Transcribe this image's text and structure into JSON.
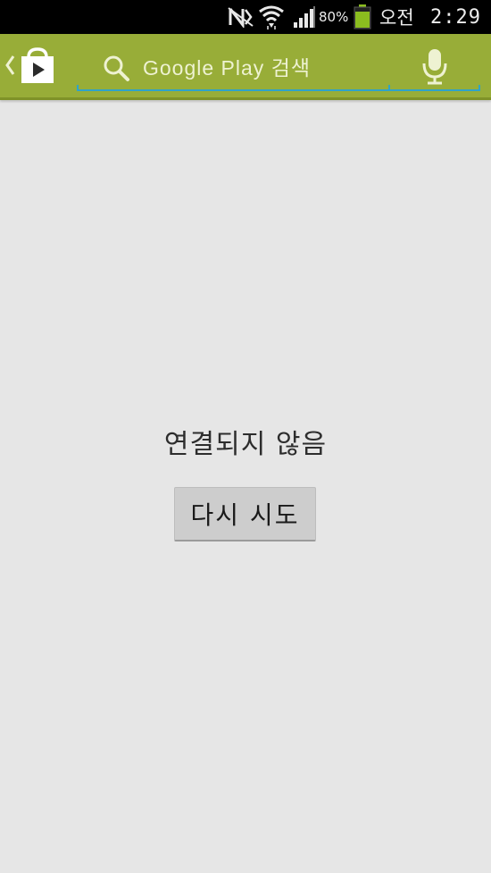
{
  "status_bar": {
    "ampm": "오전",
    "time": "2:29",
    "battery_percent": "80%",
    "icons": [
      "nfc-icon",
      "wifi-icon",
      "signal-icon",
      "battery-icon"
    ]
  },
  "app_bar": {
    "color": "#98ad38",
    "search_hint": "Google Play 검색",
    "accent_color": "#2fa3c9"
  },
  "content": {
    "message": "연결되지 않음",
    "retry_label": "다시 시도"
  }
}
